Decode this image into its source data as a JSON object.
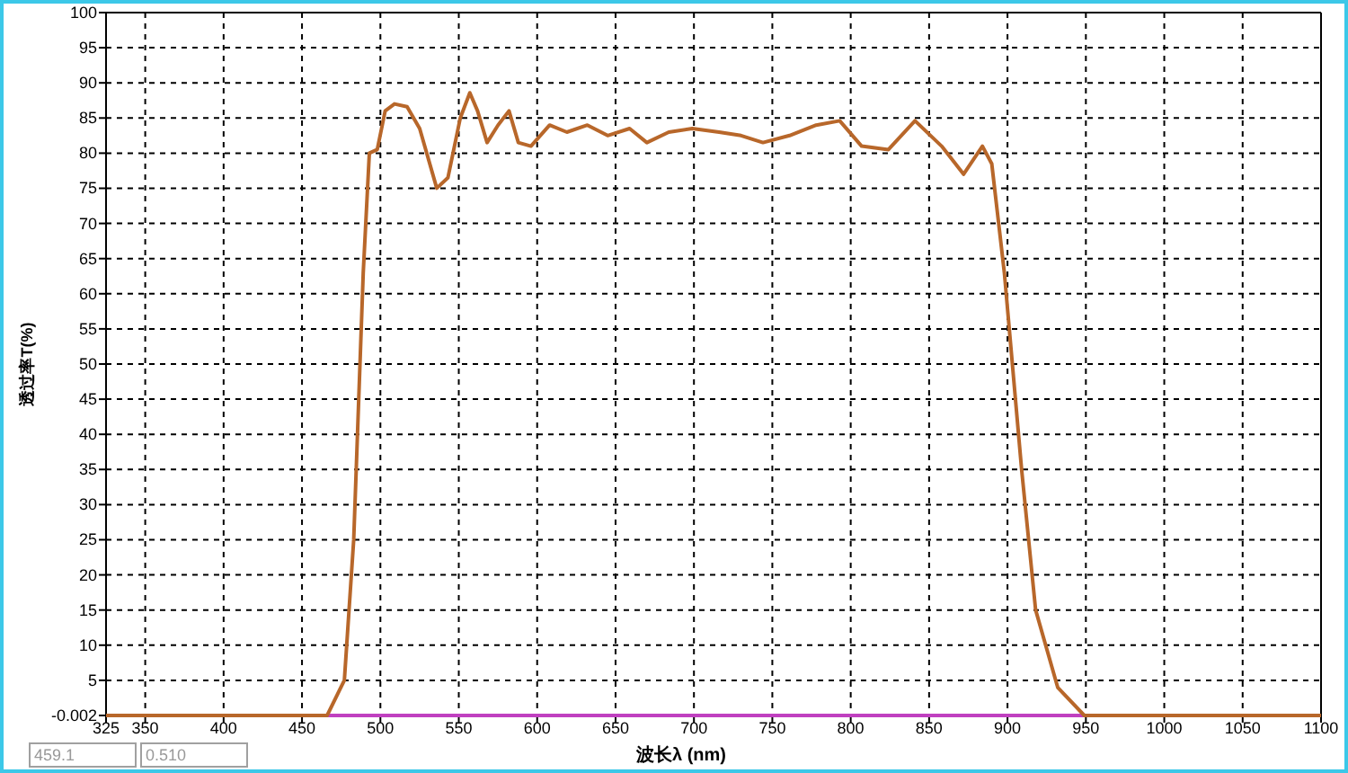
{
  "chart": {
    "chart_data": {
      "type": "line",
      "xlabel": "波长λ (nm)",
      "ylabel": "透过率T(%)",
      "grid": true,
      "xlim": [
        325,
        1100
      ],
      "ylim": [
        -0.002,
        100
      ],
      "xticks": [
        325,
        350,
        400,
        450,
        500,
        550,
        600,
        650,
        700,
        750,
        800,
        850,
        900,
        950,
        1000,
        1050,
        1100
      ],
      "yticks": [
        {
          "value": -0.002,
          "label": "-0.002"
        },
        5,
        10,
        15,
        20,
        25,
        30,
        35,
        40,
        45,
        50,
        55,
        60,
        65,
        70,
        75,
        80,
        85,
        90,
        95,
        100
      ],
      "series": [
        {
          "color": "#b8672a",
          "x": [
            325,
            450,
            466,
            477,
            483,
            489,
            493,
            498,
            503,
            509,
            517,
            525,
            536,
            543,
            551,
            557,
            562,
            568,
            575,
            582,
            588,
            596,
            608,
            619,
            632,
            645,
            659,
            670,
            684,
            699,
            716,
            730,
            744,
            761,
            778,
            793,
            807,
            824,
            841,
            858,
            872,
            884,
            890,
            898,
            909,
            918,
            932,
            949,
            1000,
            1100
          ],
          "values": [
            0,
            0,
            0,
            5,
            25,
            63,
            80,
            80.5,
            86,
            87,
            86.6,
            83.5,
            75,
            76.5,
            85,
            88.6,
            86,
            81.5,
            84,
            86,
            81.5,
            81,
            84,
            83,
            84,
            82.5,
            83.5,
            81.5,
            83,
            83.5,
            83,
            82.5,
            81.5,
            82.5,
            84,
            84.6,
            81,
            80.5,
            84.6,
            81,
            77,
            81,
            78.5,
            63,
            35,
            15,
            4,
            0,
            0,
            0
          ]
        },
        {
          "color": "#c040c0",
          "x": [
            325,
            1100
          ],
          "values": [
            0,
            0
          ]
        }
      ]
    }
  },
  "cursor_fields": [
    {
      "value": "459.1"
    },
    {
      "value": "0.510"
    }
  ]
}
